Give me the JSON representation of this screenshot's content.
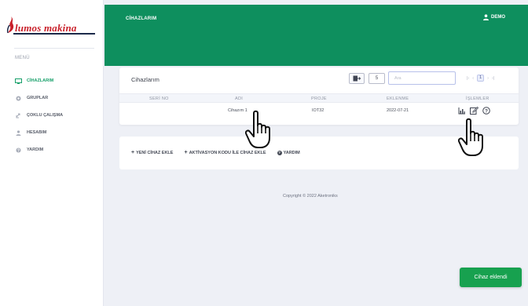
{
  "app": {
    "logo_text": "lumos makina"
  },
  "sidebar": {
    "menu_title": "MENÜ",
    "items": [
      {
        "label": "CİHAZLARIM",
        "icon": "monitor-icon",
        "active": true
      },
      {
        "label": "GRUPLAR",
        "icon": "gear-icon",
        "active": false
      },
      {
        "label": "ÇOKLU ÇALIŞMA",
        "icon": "link-icon",
        "active": false
      },
      {
        "label": "HESABIM",
        "icon": "user-icon",
        "active": false
      },
      {
        "label": "YARDIM",
        "icon": "help-icon",
        "active": false
      }
    ]
  },
  "header": {
    "title": "CİHAZLARIM",
    "user": "DEMO",
    "user_icon": "user-icon"
  },
  "devices": {
    "title": "Cihazlarım",
    "page_size": "5",
    "search_placeholder": "Ara",
    "pager": {
      "first": "|‹",
      "prev": "‹",
      "current": "1",
      "next": "›",
      "last": "›|"
    },
    "columns": [
      "SERİ NO",
      "ADI",
      "PROJE",
      "EKLENME",
      "İŞLEMLER"
    ],
    "rows": [
      {
        "serial": "",
        "name": "Cihazım 1",
        "project": "IOT32",
        "added": "2022-07-21"
      }
    ]
  },
  "links": {
    "add_device": "YENİ CİHAZ EKLE",
    "add_by_code": "AKTİVASYON KODU İLE CİHAZ EKLE",
    "help": "YARDIM"
  },
  "footer": {
    "copyright": "Copyright © 2022 Aketroniks"
  },
  "toast": {
    "text": "Cihaz eklendi"
  },
  "colors": {
    "brand_green": "#0e8f5e",
    "toast_green": "#17a14f",
    "logo_red": "#c8202a"
  }
}
